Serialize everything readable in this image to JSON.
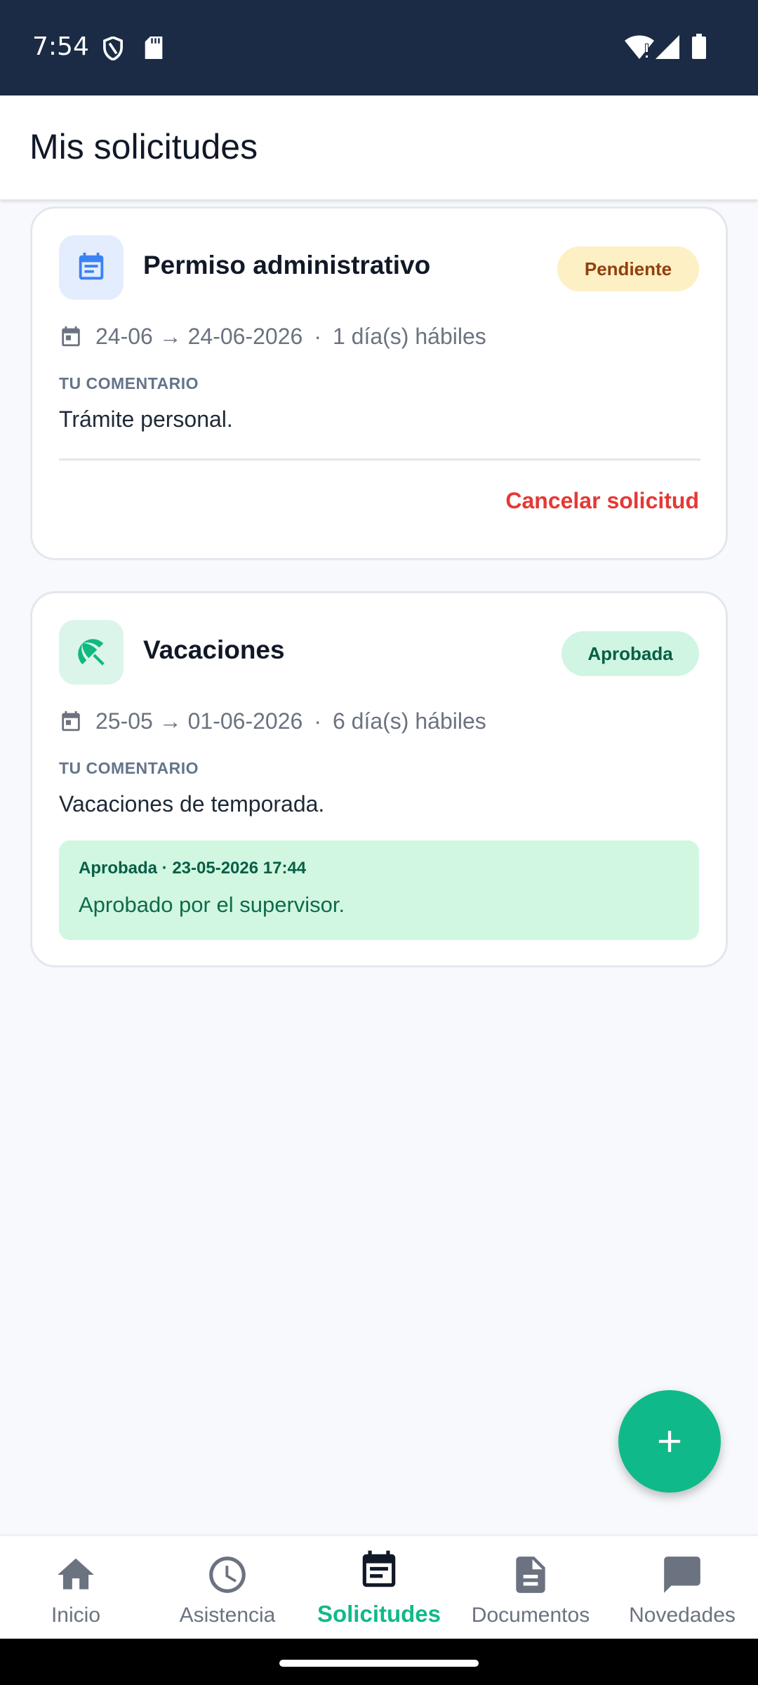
{
  "status_bar": {
    "time": "7:54"
  },
  "header": {
    "title": "Mis solicitudes"
  },
  "requests": [
    {
      "type": "Permiso administrativo",
      "status": "Pendiente",
      "dates": "24-06 → 24-06-2026",
      "separator": "·",
      "days": "1 día(s) hábiles",
      "comment_label": "TU COMENTARIO",
      "comment": "Trámite personal.",
      "action": "Cancelar solicitud"
    },
    {
      "type": "Vacaciones",
      "status": "Aprobada",
      "dates": "25-05 → 01-06-2026",
      "separator": "·",
      "days": "6 día(s) hábiles",
      "comment_label": "TU COMENTARIO",
      "comment": "Vacaciones de temporada.",
      "resolution_meta": "Aprobada · 23-05-2026 17:44",
      "resolution_text": "Aprobado por el supervisor."
    }
  ],
  "nav": [
    {
      "label": "Inicio",
      "icon": "home-icon"
    },
    {
      "label": "Asistencia",
      "icon": "clock-icon"
    },
    {
      "label": "Solicitudes",
      "icon": "event-note-icon",
      "active": true
    },
    {
      "label": "Documentos",
      "icon": "document-icon"
    },
    {
      "label": "Novedades",
      "icon": "chat-icon"
    }
  ],
  "colors": {
    "status_bar": "#1b2b45",
    "accent": "#10b98a",
    "pending_bg": "#fdf0c4",
    "pending_text": "#92400e",
    "approved_bg": "#d0f5e3",
    "approved_text": "#065f46",
    "danger": "#e53935"
  }
}
